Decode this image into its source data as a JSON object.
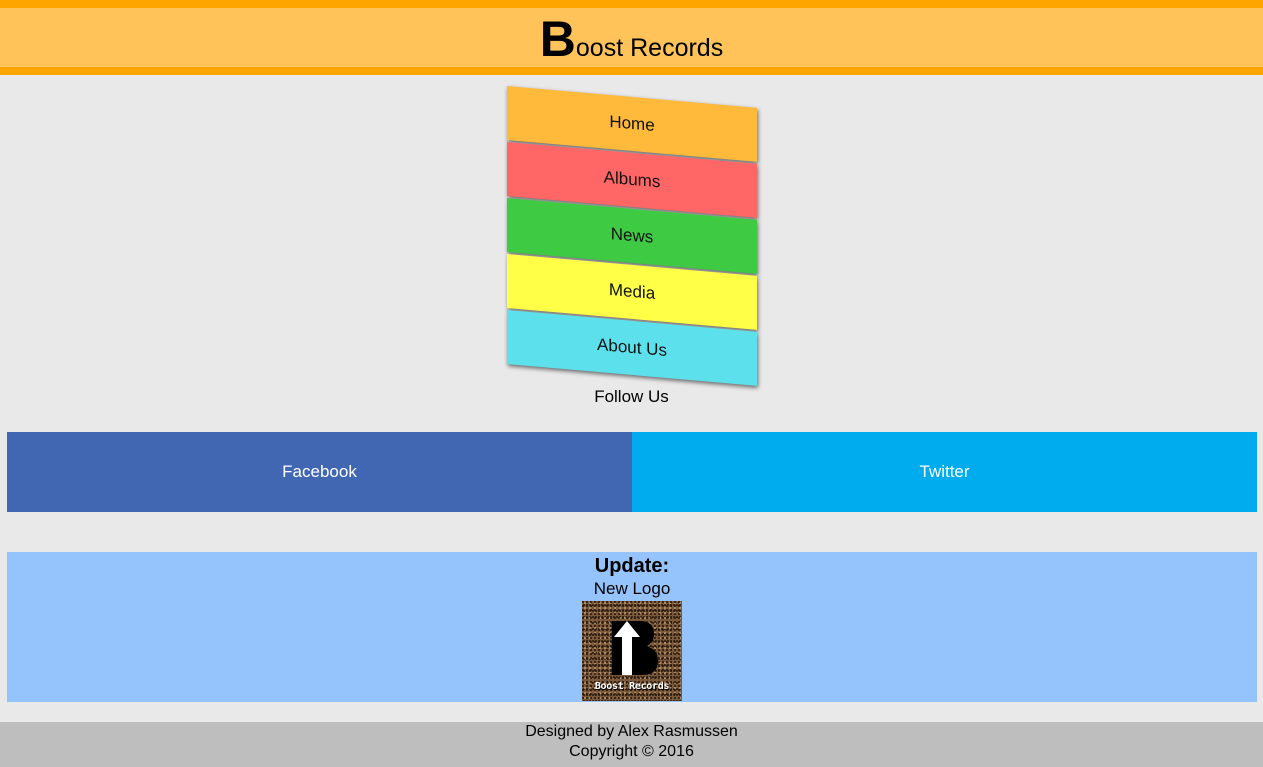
{
  "header": {
    "title_initial": "B",
    "title_rest": "oost Records"
  },
  "nav": {
    "items": [
      {
        "label": "Home",
        "color": "#ffb93b"
      },
      {
        "label": "Albums",
        "color": "#ff6666"
      },
      {
        "label": "News",
        "color": "#3fca44"
      },
      {
        "label": "Media",
        "color": "#ffff47"
      },
      {
        "label": "About Us",
        "color": "#5ce1ec"
      }
    ]
  },
  "follow": {
    "label": "Follow Us"
  },
  "social": {
    "facebook": {
      "label": "Facebook",
      "color": "#4267b2"
    },
    "twitter": {
      "label": "Twitter",
      "color": "#00acee"
    }
  },
  "update": {
    "title": "Update:",
    "subtitle": "New Logo",
    "logo_caption": "Boost Records"
  },
  "footer": {
    "designed_by": "Designed by Alex Rasmussen",
    "copyright": "Copyright © 2016"
  },
  "colors": {
    "header_border": "#ffa500",
    "header_bg": "#ffc35a",
    "page_bg": "#e9e9e9",
    "update_bg": "#95c3fc",
    "footer_bg": "#bebebe"
  }
}
